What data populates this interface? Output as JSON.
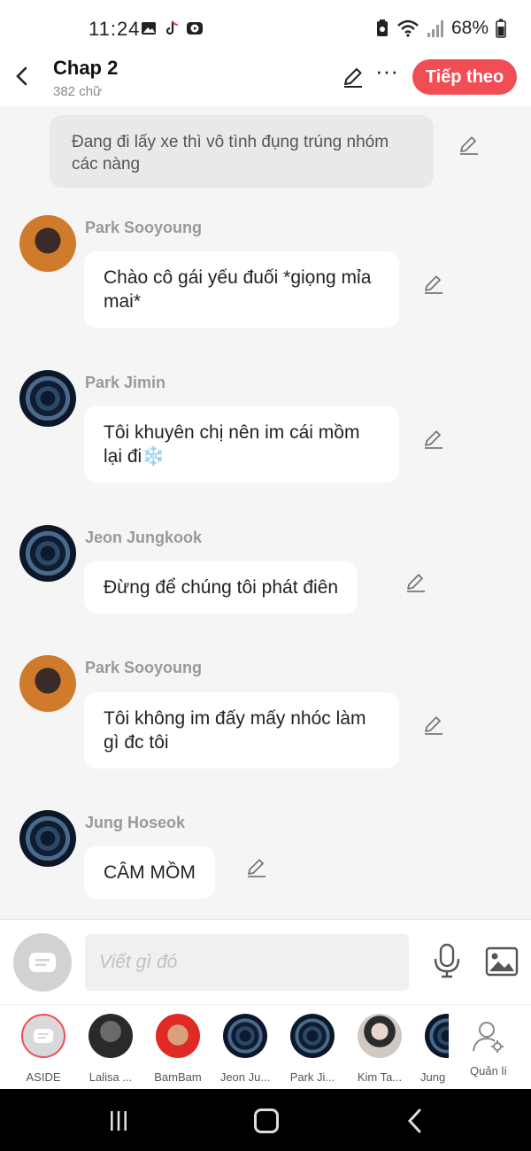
{
  "status_bar": {
    "time": "11:24",
    "battery": "68%",
    "icons": [
      "gallery-icon",
      "tiktok-icon",
      "youtube-icon",
      "recycle-battery-icon",
      "wifi-icon",
      "signal-icon",
      "battery-icon"
    ]
  },
  "header": {
    "title": "Chap 2",
    "subtitle": "382 chữ",
    "next_label": "Tiếp theo",
    "accent_color": "#f04d55"
  },
  "chat": {
    "narration": "Đang đi lấy xe thì vô tình đụng trúng nhóm các nàng",
    "messages": [
      {
        "sender": "Park Sooyoung",
        "text": "Chào cô gái yếu đuối *giọng mỉa mai*"
      },
      {
        "sender": "Park Jimin",
        "text": "Tôi khuyên chị nên im cái mồm lại đi❄️"
      },
      {
        "sender": "Jeon Jungkook",
        "text": "Đừng để chúng tôi phát điên"
      },
      {
        "sender": "Park Sooyoung",
        "text": "Tôi không im đấy mấy nhóc làm gì đc tôi"
      },
      {
        "sender": "Jung Hoseok",
        "text": "CÂM MỒM"
      }
    ]
  },
  "input_bar": {
    "placeholder": "Viết gì đó"
  },
  "characters": [
    {
      "name": "ASIDE"
    },
    {
      "name": "Lalisa ..."
    },
    {
      "name": "BamBam"
    },
    {
      "name": "Jeon Ju..."
    },
    {
      "name": "Park Ji..."
    },
    {
      "name": "Kim Ta..."
    },
    {
      "name": "Jung"
    },
    {
      "name": "Quản lí"
    }
  ]
}
